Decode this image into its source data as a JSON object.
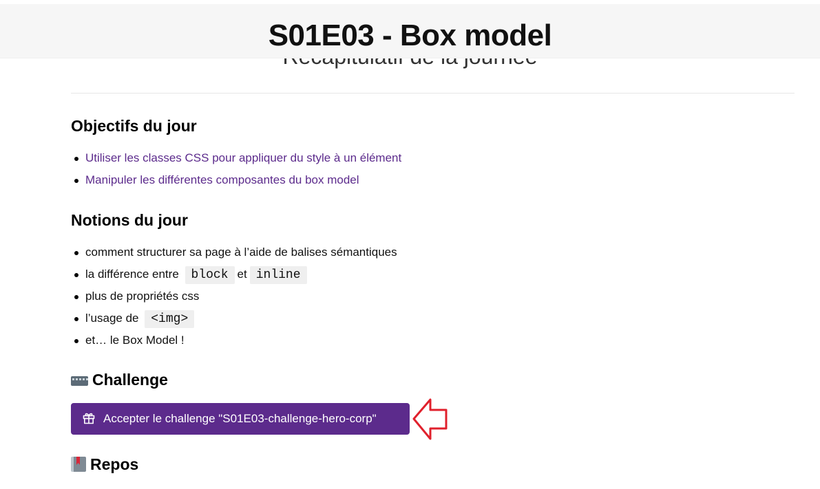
{
  "header": {
    "title": "S01E03 - Box model",
    "subtitle": "Récapitulatif de la journée"
  },
  "objectives": {
    "heading": "Objectifs du jour",
    "items": [
      "Utiliser les classes CSS pour appliquer du style à un élément",
      "Manipuler les différentes composantes du box model"
    ]
  },
  "notions": {
    "heading": "Notions du jour",
    "item1": "comment structurer sa page à l’aide de balises sémantiques",
    "item2_prefix": "la différence entre",
    "item2_code1": "block",
    "item2_mid": "et",
    "item2_code2": "inline",
    "item3": "plus de propriétés css",
    "item4_prefix": "l’usage de",
    "item4_code": "<img>",
    "item5": "et… le Box Model !"
  },
  "challenge": {
    "heading": "Challenge",
    "icon": "keyboard-icon",
    "button_label": "Accepter le challenge \"S01E03-challenge-hero-corp\"",
    "button_icon": "gift-icon",
    "button_color": "#5c2b8c"
  },
  "repos": {
    "heading": "Repos",
    "icon": "bookmark-icon"
  },
  "annotation": {
    "arrow_color": "#e0202c"
  }
}
